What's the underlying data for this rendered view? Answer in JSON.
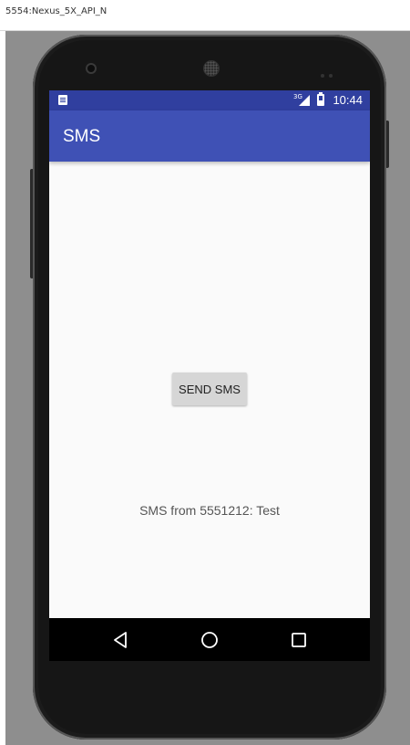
{
  "window": {
    "title": "5554:Nexus_5X_API_N"
  },
  "status_bar": {
    "network_type": "3G",
    "time": "10:44",
    "color": "#303f9f"
  },
  "app_bar": {
    "title": "SMS",
    "color": "#3f51b5"
  },
  "main": {
    "send_button_label": "SEND SMS",
    "received_message": "SMS from 5551212: Test"
  },
  "nav_bar": {
    "back_icon": "back-triangle-icon",
    "home_icon": "home-circle-icon",
    "recents_icon": "recents-square-icon"
  }
}
